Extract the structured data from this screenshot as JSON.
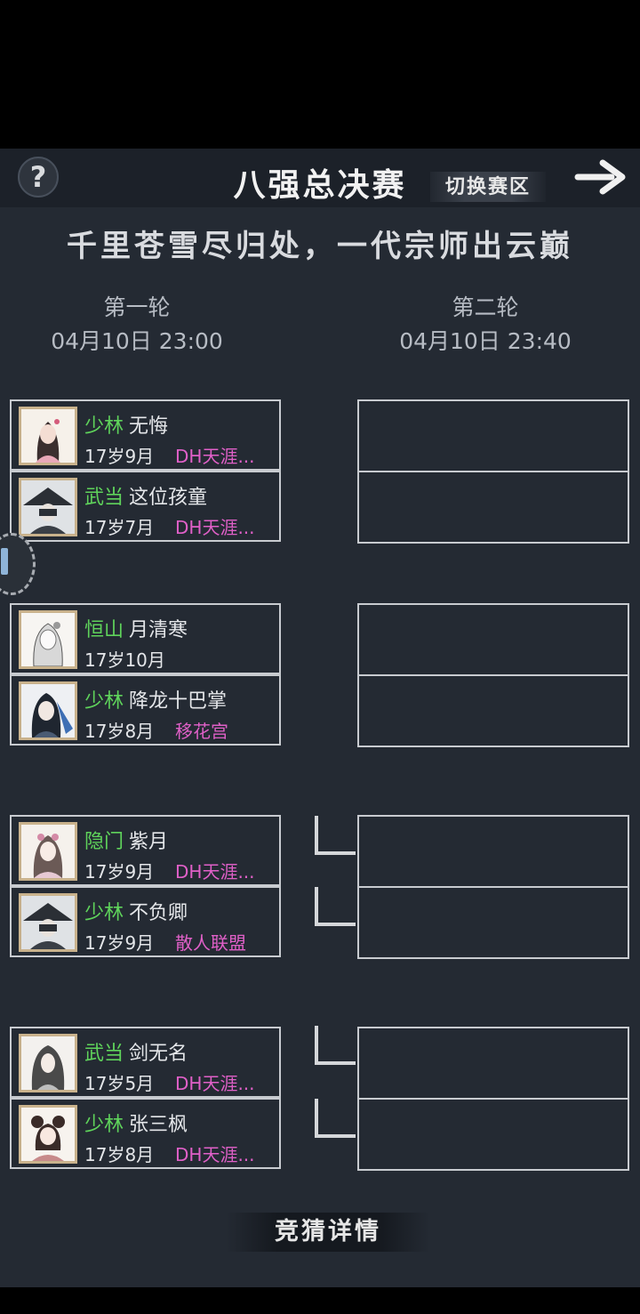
{
  "header": {
    "help_label": "?",
    "title": "八强总决赛",
    "switch_label": "切换赛区"
  },
  "slogan": "千里苍雪尽归处，一代宗师出云巅",
  "rounds": [
    {
      "label": "第一轮",
      "time": "04月10日 23:00"
    },
    {
      "label": "第二轮",
      "time": "04月10日 23:40"
    }
  ],
  "matches": [
    {
      "players": [
        {
          "sect": "少林",
          "name": "无悔",
          "age": "17岁9月",
          "guild": "DH天涯..."
        },
        {
          "sect": "武当",
          "name": "这位孩童",
          "age": "17岁7月",
          "guild": "DH天涯..."
        }
      ]
    },
    {
      "players": [
        {
          "sect": "恒山",
          "name": "月清寒",
          "age": "17岁10月",
          "guild": ""
        },
        {
          "sect": "少林",
          "name": "降龙十巴掌",
          "age": "17岁8月",
          "guild": "移花宫"
        }
      ]
    },
    {
      "players": [
        {
          "sect": "隐门",
          "name": "紫月",
          "age": "17岁9月",
          "guild": "DH天涯..."
        },
        {
          "sect": "少林",
          "name": "不负卿",
          "age": "17岁9月",
          "guild": "散人联盟"
        }
      ]
    },
    {
      "players": [
        {
          "sect": "武当",
          "name": "剑无名",
          "age": "17岁5月",
          "guild": "DH天涯..."
        },
        {
          "sect": "少林",
          "name": "张三枫",
          "age": "17岁8月",
          "guild": "DH天涯..."
        }
      ]
    }
  ],
  "guess_label": "竞猜详情",
  "colors": {
    "sect": "#5fd35b",
    "guild": "#e060c8",
    "background": "#242a33"
  }
}
